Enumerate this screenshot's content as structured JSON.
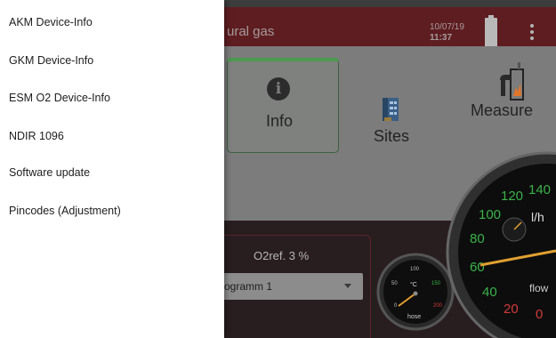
{
  "drawer": {
    "items": [
      {
        "label": "AKM Device-Info"
      },
      {
        "label": "GKM Device-Info"
      },
      {
        "label": "ESM O2 Device-Info"
      },
      {
        "label": "NDIR 1096"
      },
      {
        "label": "Software update"
      },
      {
        "label": "Pincodes (Adjustment)"
      }
    ]
  },
  "header": {
    "title": "ural gas",
    "date": "10/07/19",
    "time": "11:37"
  },
  "tiles": {
    "info": "Info",
    "sites": "Sites",
    "measure": "Measure"
  },
  "panel": {
    "o2ref": "O2ref. 3 %",
    "program": "ogramm 1"
  },
  "hose_gauge": {
    "unit": "°C",
    "name": "hose",
    "ticks": [
      "0",
      "50",
      "100",
      "150",
      "200"
    ]
  },
  "flow_gauge": {
    "unit": "l/h",
    "name": "flow",
    "ticks": [
      "0",
      "20",
      "40",
      "60",
      "80",
      "100",
      "120",
      "140"
    ]
  },
  "colors": {
    "header": "#5e1d21",
    "accent_green": "#4b9a4f",
    "gauge_green": "#3bb34a",
    "gauge_red": "#d23b3b"
  },
  "icons": {
    "info": "info-icon",
    "sites": "building-icon",
    "measure": "measure-icon",
    "menu": "more-vert-icon",
    "battery": "battery-icon"
  }
}
